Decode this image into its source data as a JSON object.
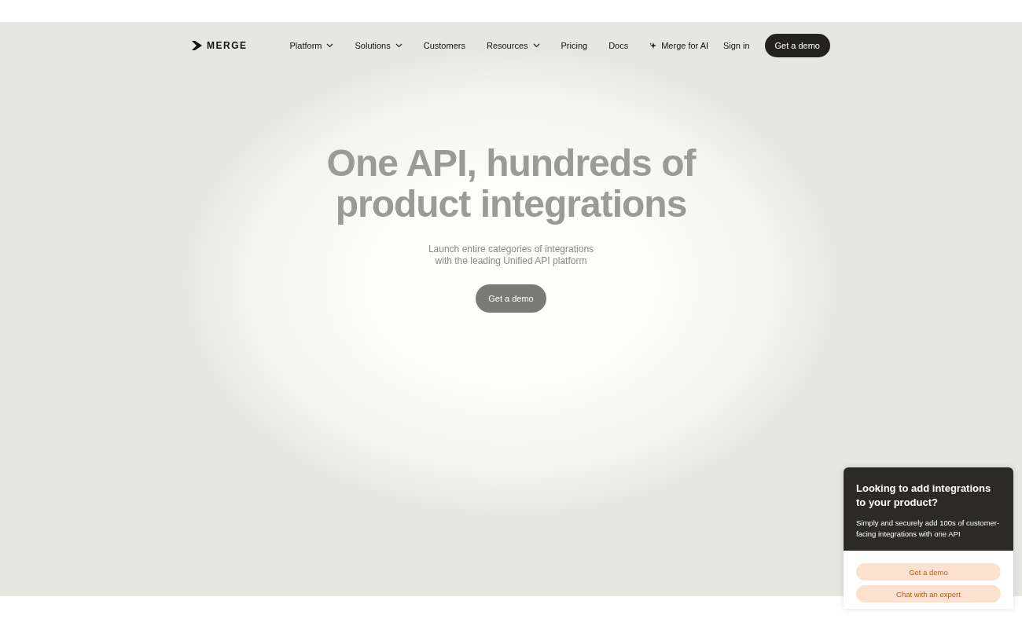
{
  "nav": {
    "logo": "MERGE",
    "items": [
      {
        "label": "Platform",
        "kind": "dropdown"
      },
      {
        "label": "Solutions",
        "kind": "dropdown"
      },
      {
        "label": "Customers",
        "kind": "link"
      },
      {
        "label": "Resources",
        "kind": "dropdown"
      },
      {
        "label": "Pricing",
        "kind": "link"
      },
      {
        "label": "Docs",
        "kind": "link"
      },
      {
        "label": "Merge for AI",
        "kind": "sparkle"
      }
    ],
    "sign_in": "Sign in",
    "cta": "Get a demo"
  },
  "hero": {
    "title": "One API, hundreds of product integrations",
    "subtitle": "Launch entire categories of integrations with the leading Unified API platform",
    "button": "Get a demo"
  },
  "popup": {
    "title": "Looking to add integrations to your product?",
    "text": "Simply and securely add 100s of customer-facing integrations with one API",
    "buttons": [
      "Get a demo",
      "Chat with an expert"
    ]
  }
}
